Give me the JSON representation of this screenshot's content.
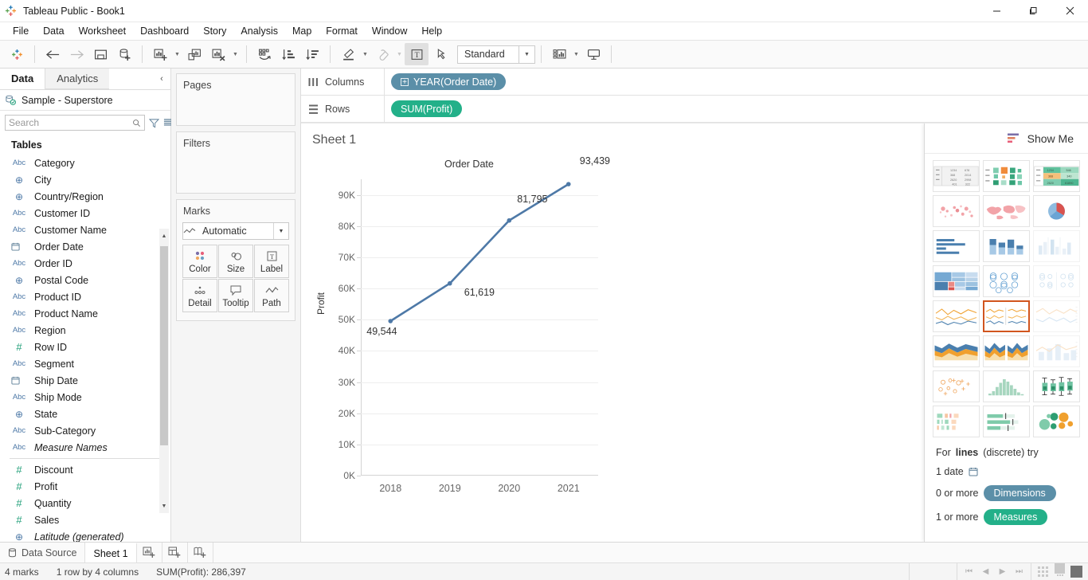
{
  "window": {
    "title": "Tableau Public - Book1",
    "minimize": "—",
    "maximize": "❐",
    "close": "✕"
  },
  "menubar": {
    "items": [
      "File",
      "Data",
      "Worksheet",
      "Dashboard",
      "Story",
      "Analysis",
      "Map",
      "Format",
      "Window",
      "Help"
    ]
  },
  "toolbar": {
    "fit_value": "Standard",
    "items": [
      {
        "name": "tableau-logo",
        "label": "Tableau"
      },
      {
        "name": "back-arrow",
        "label": "Back"
      },
      {
        "name": "forward-arrow",
        "label": "Forward"
      },
      {
        "name": "save",
        "label": "Save"
      },
      {
        "name": "new-data-source",
        "label": "New Data Source"
      },
      {
        "name": "new-worksheet",
        "label": "New Worksheet"
      },
      {
        "name": "duplicate-sheet",
        "label": "Duplicate Sheet"
      },
      {
        "name": "clear-sheet",
        "label": "Clear Sheet"
      },
      {
        "name": "swap-rows-columns",
        "label": "Swap Rows and Columns"
      },
      {
        "name": "sort-ascending",
        "label": "Sort Ascending"
      },
      {
        "name": "sort-descending",
        "label": "Sort Descending"
      },
      {
        "name": "highlight",
        "label": "Highlight"
      },
      {
        "name": "group-members",
        "label": "Group Members"
      },
      {
        "name": "show-mark-labels",
        "label": "Show Mark Labels"
      },
      {
        "name": "fix-axes",
        "label": "Fix Axes"
      },
      {
        "name": "show-hide-cards",
        "label": "Show/Hide Cards"
      },
      {
        "name": "presentation-mode",
        "label": "Presentation Mode"
      }
    ]
  },
  "left_pane": {
    "tabs": [
      {
        "label": "Data",
        "selected": true
      },
      {
        "label": "Analytics",
        "selected": false
      }
    ],
    "collapse_icon": "‹",
    "data_source": "Sample - Superstore",
    "search_placeholder": "Search",
    "search_value": "",
    "section_title": "Tables",
    "fields": [
      {
        "name": "Category",
        "type": "abc"
      },
      {
        "name": "City",
        "type": "geo"
      },
      {
        "name": "Country/Region",
        "type": "geo"
      },
      {
        "name": "Customer ID",
        "type": "abc"
      },
      {
        "name": "Customer Name",
        "type": "abc"
      },
      {
        "name": "Order Date",
        "type": "date"
      },
      {
        "name": "Order ID",
        "type": "abc"
      },
      {
        "name": "Postal Code",
        "type": "geo"
      },
      {
        "name": "Product ID",
        "type": "abc"
      },
      {
        "name": "Product Name",
        "type": "abc"
      },
      {
        "name": "Region",
        "type": "abc"
      },
      {
        "name": "Row ID",
        "type": "num"
      },
      {
        "name": "Segment",
        "type": "abc"
      },
      {
        "name": "Ship Date",
        "type": "date"
      },
      {
        "name": "Ship Mode",
        "type": "abc"
      },
      {
        "name": "State",
        "type": "geo"
      },
      {
        "name": "Sub-Category",
        "type": "abc"
      },
      {
        "name": "Measure Names",
        "type": "abc",
        "italic": true
      },
      {
        "separator": true
      },
      {
        "name": "Discount",
        "type": "num"
      },
      {
        "name": "Profit",
        "type": "num"
      },
      {
        "name": "Quantity",
        "type": "num"
      },
      {
        "name": "Sales",
        "type": "num"
      },
      {
        "name": "Latitude (generated)",
        "type": "geo",
        "italic": true
      }
    ],
    "abc_glyph": "Abc",
    "num_glyph": "#",
    "geo_glyph": "⊕",
    "date_glyph": "☷"
  },
  "cards": {
    "pages_title": "Pages",
    "filters_title": "Filters",
    "marks_title": "Marks",
    "marks_type": "Automatic",
    "buttons": [
      {
        "label": "Color",
        "icon": "color-icon"
      },
      {
        "label": "Size",
        "icon": "size-icon"
      },
      {
        "label": "Label",
        "icon": "label-icon"
      },
      {
        "label": "Detail",
        "icon": "detail-icon"
      },
      {
        "label": "Tooltip",
        "icon": "tooltip-icon"
      },
      {
        "label": "Path",
        "icon": "path-icon"
      }
    ]
  },
  "shelves": {
    "columns_label": "Columns",
    "columns_pill": "YEAR(Order Date)",
    "rows_label": "Rows",
    "rows_pill": "SUM(Profit)"
  },
  "sheet": {
    "title": "Sheet 1"
  },
  "chart_data": {
    "type": "line",
    "title": "Order Date",
    "xlabel": "Order Date",
    "ylabel": "Profit",
    "categories": [
      "2018",
      "2019",
      "2020",
      "2021"
    ],
    "values": [
      49544,
      61619,
      81795,
      93439
    ],
    "data_labels": [
      "49,544",
      "61,619",
      "81,795",
      "93,439"
    ],
    "ylim": [
      0,
      95000
    ],
    "ytick_labels": [
      "0K",
      "10K",
      "20K",
      "30K",
      "40K",
      "50K",
      "60K",
      "70K",
      "80K",
      "90K"
    ],
    "ytick_values": [
      0,
      10000,
      20000,
      30000,
      40000,
      50000,
      60000,
      70000,
      80000,
      90000
    ],
    "grid": true,
    "legend": "none",
    "line_color": "#4e79a7",
    "marker_color": "#4e79a7"
  },
  "show_me": {
    "title": "Show Me",
    "cells": [
      {
        "name": "text-table",
        "selected": false
      },
      {
        "name": "heat-map",
        "selected": false
      },
      {
        "name": "highlight-table",
        "selected": false
      },
      {
        "name": "symbol-map",
        "selected": false
      },
      {
        "name": "filled-map",
        "selected": false
      },
      {
        "name": "pie-chart",
        "selected": false
      },
      {
        "name": "horizontal-bars",
        "selected": false
      },
      {
        "name": "stacked-bars",
        "selected": false
      },
      {
        "name": "side-by-side-bars",
        "selected": false
      },
      {
        "name": "treemap",
        "selected": false
      },
      {
        "name": "circle-views",
        "selected": false
      },
      {
        "name": "side-by-side-circle-views",
        "selected": false
      },
      {
        "name": "lines-continuous",
        "selected": false
      },
      {
        "name": "lines-discrete",
        "selected": true
      },
      {
        "name": "dual-lines",
        "selected": false
      },
      {
        "name": "area-charts-continuous",
        "selected": false
      },
      {
        "name": "area-charts-discrete",
        "selected": false
      },
      {
        "name": "dual-combination",
        "selected": false
      },
      {
        "name": "scatter-plot",
        "selected": false
      },
      {
        "name": "histogram",
        "selected": false
      },
      {
        "name": "box-and-whisker",
        "selected": false
      },
      {
        "name": "gantt",
        "selected": false
      },
      {
        "name": "bullet-graph",
        "selected": false
      },
      {
        "name": "packed-bubbles",
        "selected": false
      }
    ],
    "hint_prefix": "For ",
    "hint_bold": "lines",
    "hint_suffix": " (discrete) try",
    "req_date": "1 date",
    "req_dims_prefix": "0 or more",
    "req_dims_pill": "Dimensions",
    "req_meas_prefix": "1 or more",
    "req_meas_pill": "Measures"
  },
  "bottom": {
    "data_source_tab": "Data Source",
    "sheet_tab": "Sheet 1",
    "new_worksheet_tip": "New Worksheet",
    "new_dashboard_tip": "New Dashboard",
    "new_story_tip": "New Story"
  },
  "status": {
    "marks": "4 marks",
    "rows_cols": "1 row by 4 columns",
    "sum": "SUM(Profit): 286,397",
    "nav": [
      "⏮",
      "◀",
      "▶",
      "⏭"
    ]
  },
  "colors": {
    "pill_blue": "#5b8fa8",
    "pill_green": "#23b089",
    "line": "#4e79a7",
    "accent_selected": "#d1551f"
  }
}
